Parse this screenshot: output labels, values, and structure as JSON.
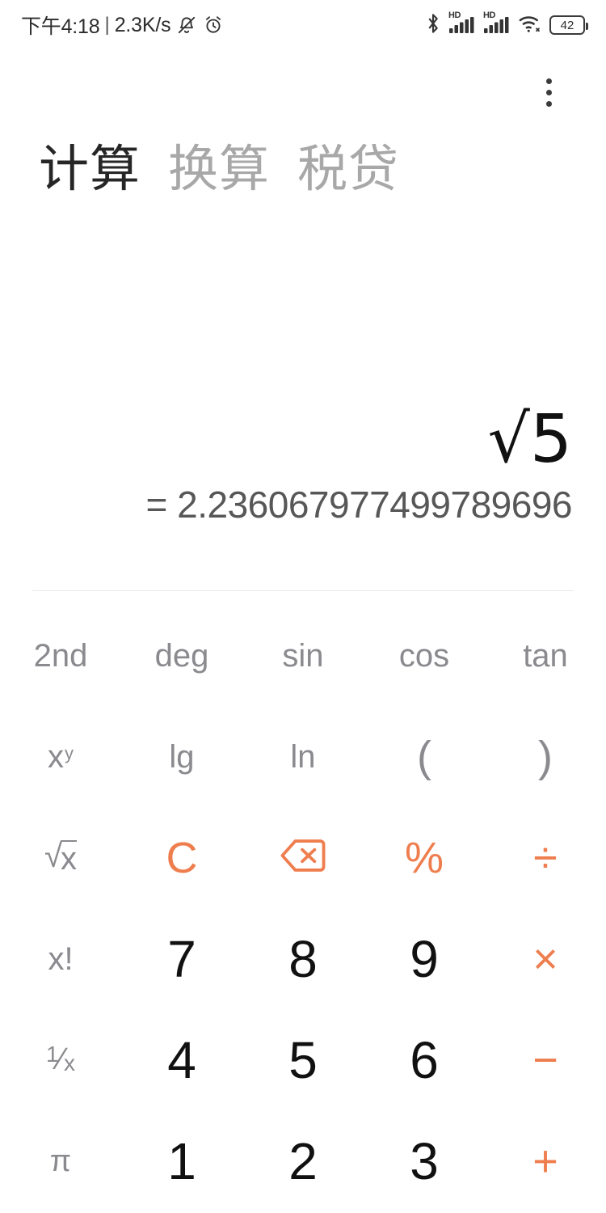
{
  "status_bar": {
    "time": "下午4:18",
    "separator": "|",
    "network_speed": "2.3K/s",
    "icons": [
      "mute-icon",
      "alarm-icon",
      "bluetooth-icon",
      "signal-hd-1-icon",
      "signal-hd-2-icon",
      "wifi-icon",
      "battery-icon"
    ],
    "hd_label": "HD",
    "battery_level": "42"
  },
  "app_bar": {
    "overflow_label": "更多",
    "tabs": [
      {
        "label": "计算",
        "active": true
      },
      {
        "label": "换算",
        "active": false
      },
      {
        "label": "税贷",
        "active": false
      }
    ]
  },
  "display": {
    "expression": "√5",
    "result": "= 2.236067977499789696"
  },
  "keypad": {
    "rows": [
      [
        {
          "name": "key-2nd",
          "label": "2nd",
          "style": "fn gray"
        },
        {
          "name": "key-deg",
          "label": "deg",
          "style": "fn gray"
        },
        {
          "name": "key-sin",
          "label": "sin",
          "style": "fn gray"
        },
        {
          "name": "key-cos",
          "label": "cos",
          "style": "fn gray"
        },
        {
          "name": "key-tan",
          "label": "tan",
          "style": "fn gray"
        }
      ],
      [
        {
          "name": "key-power",
          "label": "x^y",
          "style": "fn gray"
        },
        {
          "name": "key-lg",
          "label": "lg",
          "style": "fn gray"
        },
        {
          "name": "key-ln",
          "label": "ln",
          "style": "fn gray"
        },
        {
          "name": "key-paren-open",
          "label": "(",
          "style": "fn gray"
        },
        {
          "name": "key-paren-close",
          "label": ")",
          "style": "fn gray"
        }
      ],
      [
        {
          "name": "key-sqrt",
          "label": "√x",
          "style": "fn gray"
        },
        {
          "name": "key-clear",
          "label": "C",
          "style": "op orange"
        },
        {
          "name": "key-backspace",
          "label": "backspace-icon",
          "style": "icon orange"
        },
        {
          "name": "key-percent",
          "label": "%",
          "style": "op orange"
        },
        {
          "name": "key-divide",
          "label": "÷",
          "style": "op orange"
        }
      ],
      [
        {
          "name": "key-factorial",
          "label": "x!",
          "style": "fn gray"
        },
        {
          "name": "key-7",
          "label": "7",
          "style": "num dark"
        },
        {
          "name": "key-8",
          "label": "8",
          "style": "num dark"
        },
        {
          "name": "key-9",
          "label": "9",
          "style": "num dark"
        },
        {
          "name": "key-multiply",
          "label": "×",
          "style": "op orange"
        }
      ],
      [
        {
          "name": "key-reciprocal",
          "label": "1/x",
          "style": "fn gray"
        },
        {
          "name": "key-4",
          "label": "4",
          "style": "num dark"
        },
        {
          "name": "key-5",
          "label": "5",
          "style": "num dark"
        },
        {
          "name": "key-6",
          "label": "6",
          "style": "num dark"
        },
        {
          "name": "key-subtract",
          "label": "−",
          "style": "op orange"
        }
      ],
      [
        {
          "name": "key-pi",
          "label": "π",
          "style": "fn gray"
        },
        {
          "name": "key-1",
          "label": "1",
          "style": "num dark"
        },
        {
          "name": "key-2",
          "label": "2",
          "style": "num dark"
        },
        {
          "name": "key-3",
          "label": "3",
          "style": "num dark"
        },
        {
          "name": "key-add",
          "label": "+",
          "style": "op orange"
        }
      ]
    ]
  },
  "colors": {
    "accent_orange": "#ef7e4f",
    "text_dark": "#111111",
    "text_gray": "#8a8a8f",
    "tab_inactive": "#a8a8a8",
    "result_gray": "#575757",
    "divider": "#e8e8e8",
    "background": "#ffffff"
  }
}
